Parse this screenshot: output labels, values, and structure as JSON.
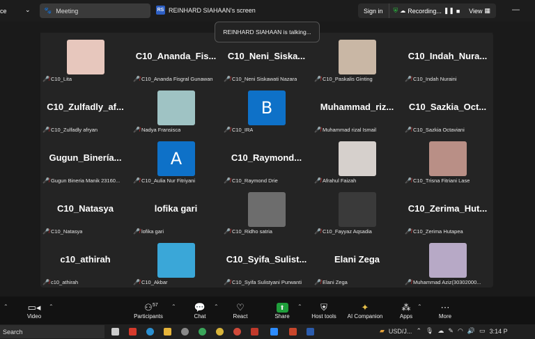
{
  "titlebar": {
    "app_fragment": "ce",
    "meeting_label": "Meeting",
    "screen_badge": "RS",
    "screen_title": "REINHARD SIAHAAN's screen",
    "signin": "Sign in",
    "recording": "Recording...",
    "view": "View"
  },
  "toast": "REINHARD SIAHAAN is talking...",
  "tiles": [
    {
      "name": "",
      "label": "C10_Lita",
      "photo": "#e7c7bd"
    },
    {
      "name": "C10_Ananda_Fis...",
      "label": "C10_Ananda Fisgral Gunawan"
    },
    {
      "name": "C10_Neni_Siska...",
      "label": "C10_Neni Siskawati Nazara"
    },
    {
      "name": "",
      "label": "C10_Paskalis Ginting",
      "photo": "#c9b7a5"
    },
    {
      "name": "C10_Indah_Nura...",
      "label": "C10_Indah Nuraini"
    },
    {
      "name": "C10_Zulfadly_af...",
      "label": "C10_Zulfadly afryan"
    },
    {
      "name": "",
      "label": "Nadya Fransisca",
      "photo": "#9fc3c4"
    },
    {
      "name": "",
      "label": "C10_IRA",
      "letter": "B"
    },
    {
      "name": "Muhammad_riz...",
      "label": "Muhammad rizal Ismail"
    },
    {
      "name": "C10_Sazkia_Oct...",
      "label": "C10_Sazkia Octaviani"
    },
    {
      "name": "Gugun_Binería...",
      "label": "Gugun Bineria Manik 23160..."
    },
    {
      "name": "",
      "label": "C10_Aulia Nur Fitriyani",
      "letter": "A"
    },
    {
      "name": "C10_Raymond...",
      "label": "C10_Raymond Drie"
    },
    {
      "name": "",
      "label": "Afrahul Faizah",
      "photo": "#d6d0cc"
    },
    {
      "name": "",
      "label": "C10_Trisna Fitriani Lase",
      "photo": "#b98f86"
    },
    {
      "name": "C10_Natasya",
      "label": "C10_Natasya"
    },
    {
      "name": "lofika gari",
      "label": "lofika gari"
    },
    {
      "name": "",
      "label": "C10_Ridho satria",
      "photo": "#6d6d6d"
    },
    {
      "name": "",
      "label": "C10_Fayyaz Aqsadia",
      "photo": "#3a3a3a"
    },
    {
      "name": "C10_Zerima_Hut...",
      "label": "C10_Zerima Hutapea"
    },
    {
      "name": "c10_athirah",
      "label": "c10_athirah"
    },
    {
      "name": "",
      "label": "C10_Akbar",
      "photo": "#3aa7d8"
    },
    {
      "name": "C10_Syifa_Sulist...",
      "label": "C10_Syifa Sulistyani Purwanti"
    },
    {
      "name": "Elani Zega",
      "label": "Elani Zega"
    },
    {
      "name": "",
      "label": "Muhammad Aziz(30302000...",
      "photo": "#b7a9c6"
    }
  ],
  "toolbar": {
    "video": "Video",
    "participants": "Participants",
    "participants_count": "57",
    "chat": "Chat",
    "react": "React",
    "share": "Share",
    "host_tools": "Host tools",
    "ai_companion": "AI Companion",
    "apps": "Apps",
    "more": "More"
  },
  "taskbar": {
    "search": "Search",
    "currency": "USD/J...",
    "time": "3:14 P"
  }
}
